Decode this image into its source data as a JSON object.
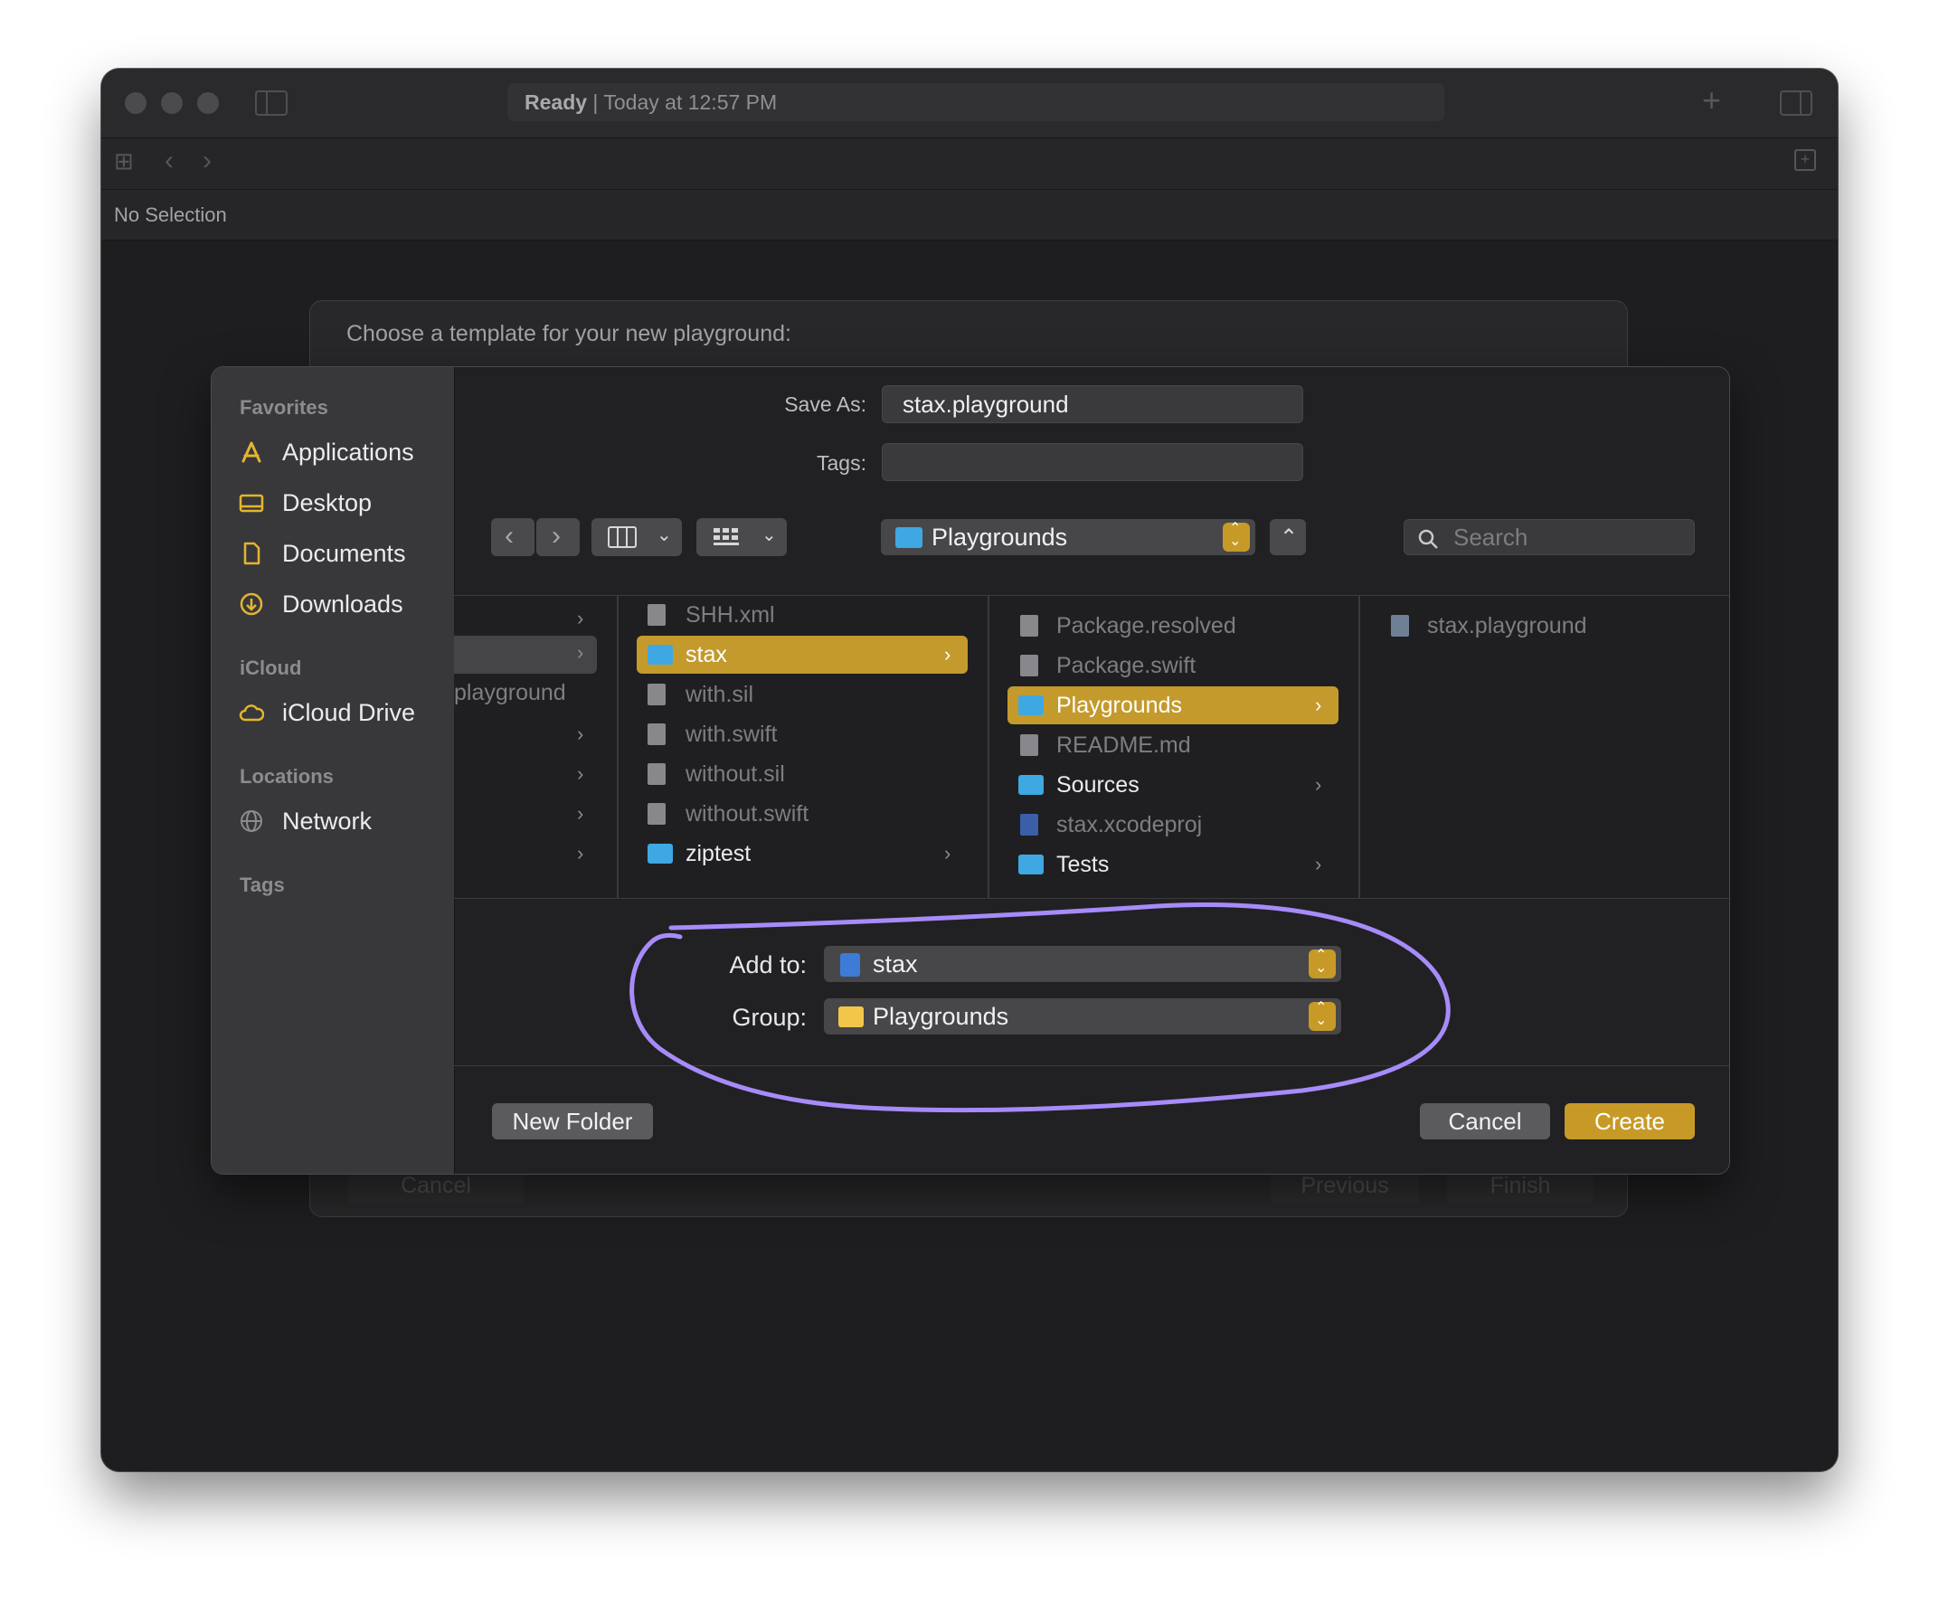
{
  "window": {
    "status_bold": "Ready",
    "status_rest": " | Today at 12:57 PM",
    "no_selection": "No Selection"
  },
  "template_sheet": {
    "title": "Choose a template for your new playground:",
    "cancel": "Cancel",
    "previous": "Previous",
    "finish": "Finish"
  },
  "sidebar": {
    "favorites_header": "Favorites",
    "favorites": [
      "Applications",
      "Desktop",
      "Documents",
      "Downloads"
    ],
    "icloud_header": "iCloud",
    "icloud": [
      "iCloud Drive"
    ],
    "locations_header": "Locations",
    "locations": [
      "Network"
    ],
    "tags_header": "Tags"
  },
  "form": {
    "save_as_label": "Save As:",
    "save_as_value": "stax.playground",
    "tags_label": "Tags:",
    "tags_value": "",
    "location": "Playgrounds",
    "search_placeholder": "Search"
  },
  "browser": {
    "col1_partial": "playground",
    "col2": [
      "SHH.xml",
      "stax",
      "with.sil",
      "with.swift",
      "without.sil",
      "without.swift",
      "ziptest"
    ],
    "col3": [
      "Package.resolved",
      "Package.swift",
      "Playgrounds",
      "README.md",
      "Sources",
      "stax.xcodeproj",
      "Tests"
    ],
    "col4": [
      "stax.playground"
    ]
  },
  "options": {
    "add_to_label": "Add to:",
    "add_to_value": "stax",
    "group_label": "Group:",
    "group_value": "Playgrounds"
  },
  "buttons": {
    "new_folder": "New Folder",
    "cancel": "Cancel",
    "create": "Create"
  },
  "colors": {
    "accent": "#c79a28",
    "folder": "#3fa7e2",
    "annotation": "#a78bfa"
  }
}
